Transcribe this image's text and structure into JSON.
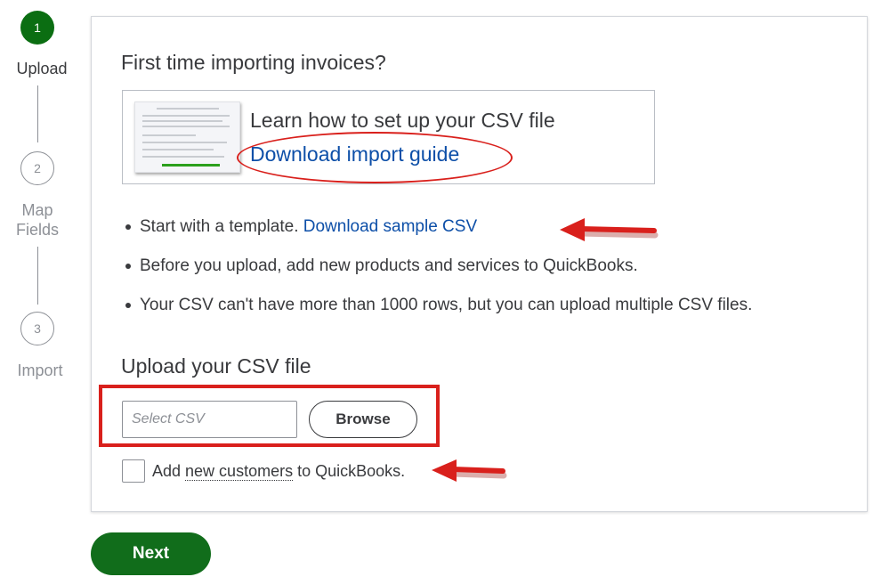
{
  "stepper": {
    "steps": [
      {
        "number": "1",
        "label": "Upload",
        "state": "active"
      },
      {
        "number": "2",
        "label_line1": "Map",
        "label_line2": "Fields",
        "state": "inactive"
      },
      {
        "number": "3",
        "label": "Import",
        "state": "inactive"
      }
    ]
  },
  "main": {
    "heading": "First time importing invoices?",
    "guide": {
      "title": "Learn how to set up your CSV file",
      "link": "Download import guide"
    },
    "bullets": {
      "item1_text": "Start with a template. ",
      "item1_link": "Download sample CSV",
      "item2": "Before you upload, add new products and services to QuickBooks.",
      "item3": "Your CSV can't have more than 1000 rows, but you can upload multiple CSV files."
    },
    "upload": {
      "heading": "Upload your CSV file",
      "input_placeholder": "Select CSV",
      "browse_label": "Browse"
    },
    "checkbox": {
      "prefix": "Add ",
      "underlined": "new customers",
      "suffix": " to QuickBooks.",
      "checked": false
    }
  },
  "footer": {
    "next_label": "Next"
  },
  "colors": {
    "primary_green": "#116d1b",
    "link_blue": "#0d4fa8",
    "annotation_red": "#d9201c",
    "text": "#393a3d",
    "muted": "#8d9096"
  }
}
